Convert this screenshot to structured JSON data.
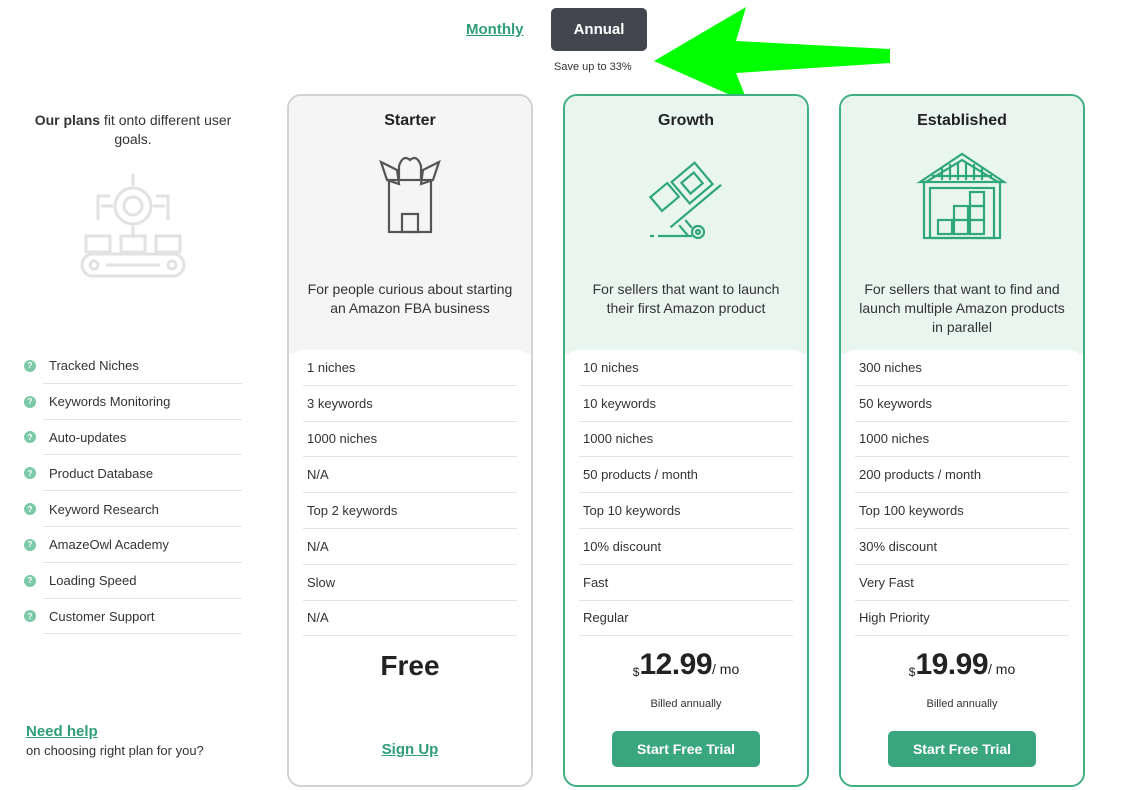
{
  "billing": {
    "monthly_label": "Monthly",
    "annual_label": "Annual",
    "save_note": "Save up to 33%",
    "selected": "Annual"
  },
  "intro": {
    "bold": "Our plans",
    "rest": " fit onto different user goals."
  },
  "features": [
    {
      "label": "Tracked Niches"
    },
    {
      "label": "Keywords Monitoring"
    },
    {
      "label": "Auto-updates"
    },
    {
      "label": "Product Database"
    },
    {
      "label": "Keyword Research"
    },
    {
      "label": "AmazeOwl Academy"
    },
    {
      "label": "Loading Speed"
    },
    {
      "label": "Customer Support"
    }
  ],
  "hint_glyph": "?",
  "help": {
    "link": "Need help",
    "text": "on choosing right plan for you?"
  },
  "plans": {
    "starter": {
      "name": "Starter",
      "description": "For people curious about starting an Amazon FBA business",
      "values": [
        "1 niches",
        "3 keywords",
        "1000 niches",
        "N/A",
        "Top 2 keywords",
        "N/A",
        "Slow",
        "N/A"
      ],
      "price_label": "Free",
      "cta": "Sign Up"
    },
    "growth": {
      "name": "Growth",
      "description": "For sellers that want to launch their first Amazon product",
      "values": [
        "10 niches",
        "10 keywords",
        "1000 niches",
        "50 products / month",
        "Top 10 keywords",
        "10% discount",
        "Fast",
        "Regular"
      ],
      "currency": "$",
      "price": "12.99",
      "period": "/ mo",
      "billed": "Billed annually",
      "cta": "Start Free Trial"
    },
    "established": {
      "name": "Established",
      "description": "For sellers that want to find and launch multiple Amazon products in parallel",
      "values": [
        "300 niches",
        "50 keywords",
        "1000 niches",
        "200 products / month",
        "Top 100 keywords",
        "30% discount",
        "Very Fast",
        "High Priority"
      ],
      "currency": "$",
      "price": "19.99",
      "period": "/ mo",
      "billed": "Billed annually",
      "cta": "Start Free Trial"
    }
  },
  "colors": {
    "accent": "#3aa67f",
    "dark_button": "#42474f",
    "arrow": "#00ff00"
  }
}
